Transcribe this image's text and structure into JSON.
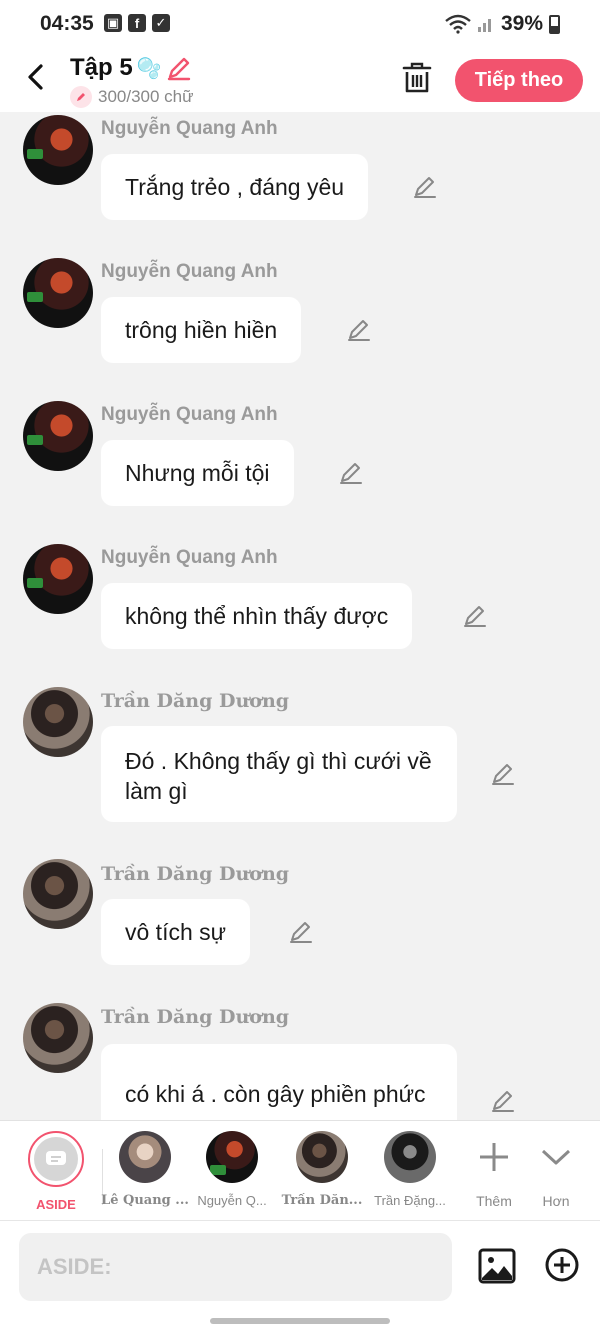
{
  "status_bar": {
    "time": "04:35",
    "battery": "39%",
    "left_icons": [
      "gallery-icon",
      "facebook-icon",
      "check-icon"
    ],
    "right_icons": [
      "wifi-icon",
      "signal-icon",
      "battery-icon"
    ]
  },
  "header": {
    "title": "Tập 5",
    "title_emoji": "🫧",
    "word_count": "300/300 chữ",
    "next_label": "Tiếp theo",
    "accent_color": "#f2536e"
  },
  "messages": [
    {
      "sender": "Nguyễn Quang Anh",
      "text": "Trắng trẻo , đáng yêu"
    },
    {
      "sender": "Nguyễn Quang Anh",
      "text": "trông hiền hiền"
    },
    {
      "sender": "Nguyễn Quang Anh",
      "text": "Nhưng mỗi tội"
    },
    {
      "sender": "Nguyễn Quang Anh",
      "text": "không thể nhìn thấy được"
    },
    {
      "sender": "Trần Dăng Dương",
      "text": "Đó . Không thấy gì thì cưới về làm gì"
    },
    {
      "sender": "Trần Dăng Dương",
      "text": "vô tích sự"
    },
    {
      "sender": "Trần Dăng Dương",
      "text": "có khi á . còn gây phiền phức"
    }
  ],
  "characters": [
    {
      "name": "ASIDE"
    },
    {
      "name": "Lê Quang ..."
    },
    {
      "name": "Nguyễn Q..."
    },
    {
      "name": "Trần Dăn..."
    },
    {
      "name": "Trần Đặng..."
    }
  ],
  "tools": {
    "more_label": "Thêm",
    "collapse_label": "Hơn"
  },
  "input": {
    "placeholder": "ASIDE:"
  }
}
